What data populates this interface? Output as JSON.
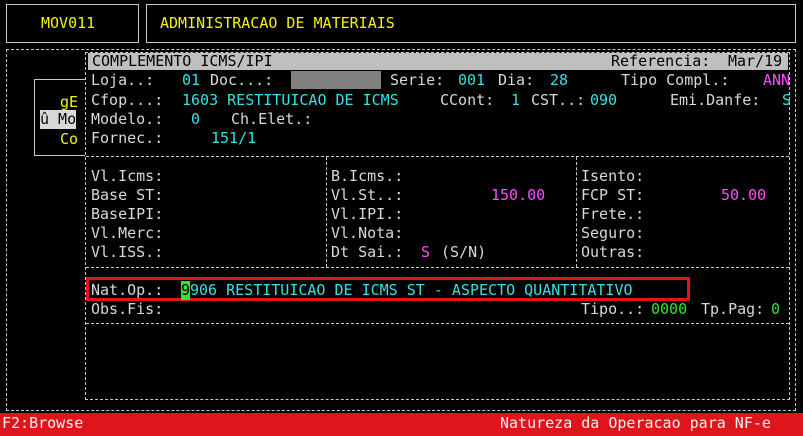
{
  "header": {
    "program_code": "MOV011",
    "module_title": "ADMINISTRACAO DE MATERIAIS"
  },
  "background_menu": {
    "items": [
      "gE",
      "û Mo",
      "Co"
    ]
  },
  "dialog": {
    "title": "COMPLEMENTO ICMS/IPI",
    "reference_label": "Referencia:",
    "reference_value": "Mar/19",
    "row1": {
      "loja_label": "Loja..:",
      "loja_value": "01",
      "doc_label": "Doc...:",
      "doc_value": "",
      "serie_label": "Serie:",
      "serie_value": "001",
      "dia_label": "Dia:",
      "dia_value": "28",
      "tipo_compl_label": "Tipo Compl.:",
      "tipo_compl_value": "ANN"
    },
    "row2": {
      "cfop_label": "Cfop...:",
      "cfop_value": "1603 RESTITUICAO DE ICMS",
      "ccont_label": "CCont:",
      "ccont_value": "1",
      "cst_label": "CST..:",
      "cst_value": "090",
      "emi_label": "Emi.Danfe:",
      "emi_value": "S"
    },
    "row3": {
      "modelo_label": "Modelo.:",
      "modelo_value": "0",
      "chelet_label": "Ch.Elet.:",
      "chelet_value": ""
    },
    "row4": {
      "fornec_label": "Fornec.:",
      "fornec_value": "151/1"
    },
    "col1": {
      "vl_icms": "Vl.Icms:",
      "base_st": "Base ST:",
      "baseipi": "BaseIPI:",
      "vl_merc": "Vl.Merc:",
      "vl_iss": "Vl.ISS.:"
    },
    "col2": {
      "b_icms": "B.Icms.:",
      "vl_st": "Vl.St..:",
      "vl_st_value": "150.00",
      "vl_ipi": "Vl.IPI.:",
      "vl_nota": "Vl.Nota:",
      "dt_sai": "Dt Sai.:",
      "dt_sai_value": "S",
      "dt_sai_hint": "(S/N)"
    },
    "col3": {
      "isento": "Isento:",
      "fcp_st": "FCP ST:",
      "fcp_st_value": "50.00",
      "frete": "Frete.:",
      "seguro": "Seguro:",
      "outras": "Outras:"
    },
    "natop": {
      "label": "Nat.Op.:",
      "cursor_char": "9",
      "value_rest": "906 RESTITUICAO DE ICMS ST - ASPECTO QUANTITATIVO"
    },
    "obs": {
      "obs_label": "Obs.Fis:",
      "tipo_label": "Tipo..:",
      "tipo_value": "0000",
      "tppag_label": "Tp.Pag:",
      "tppag_value": "0"
    }
  },
  "statusbar": {
    "left": "F2:Browse",
    "right": "Natureza da Operacao para NF-e"
  },
  "colors": {
    "label": "#d8d8d8",
    "value": "#34e2e2",
    "amount": "#ff4cff",
    "header": "#f4f400",
    "cursor": "#2ee62e",
    "highlight": "#e0151b"
  }
}
